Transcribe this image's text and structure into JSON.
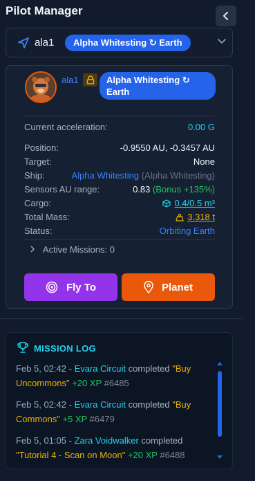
{
  "header": {
    "title": "Pilot Manager"
  },
  "selector": {
    "pilot": "ala1",
    "location": "Alpha Whitesting ↻ Earth"
  },
  "card": {
    "pilot": "ala1",
    "location": "Alpha Whitesting ↻ Earth",
    "acceleration": {
      "label": "Current acceleration:",
      "value": "0.00 G"
    },
    "position": {
      "label": "Position:",
      "value": "-0.9550 AU, -0.3457 AU"
    },
    "target": {
      "label": "Target:",
      "value": "None"
    },
    "ship": {
      "label": "Ship:",
      "name": "Alpha Whitesting",
      "alias": "(Alpha Whitesting)"
    },
    "sensors": {
      "label": "Sensors AU range:",
      "value": "0.83",
      "bonus": "(Bonus +135%)"
    },
    "cargo": {
      "label": "Cargo:",
      "value": "0.4/0.5 m³"
    },
    "mass": {
      "label": "Total Mass:",
      "value": "3.318 t"
    },
    "status": {
      "label": "Status:",
      "value": "Orbiting Earth"
    },
    "active_missions": "Active Missions: 0",
    "fly_label": "Fly To",
    "planet_label": "Planet"
  },
  "log": {
    "title": "MISSION LOG",
    "entries": [
      {
        "time": "Feb 5, 02:42",
        "who": "Evara Circuit",
        "action": "completed",
        "quest": "\"Buy Uncommons\"",
        "xp": "+20 XP",
        "id": "#6485"
      },
      {
        "time": "Feb 5, 02:42",
        "who": "Evara Circuit",
        "action": "completed",
        "quest": "\"Buy Commons\"",
        "xp": "+5 XP",
        "id": "#6479"
      },
      {
        "time": "Feb 5, 01:05",
        "who": "Zara Voidwalker",
        "action": "completed",
        "quest": "\"Tutorial 4 - Scan on Moon\"",
        "xp": "+20 XP",
        "id": "#6488"
      }
    ]
  },
  "colors": {
    "accent_blue": "#2563eb",
    "fly_purple": "#9333ea",
    "planet_orange": "#ea580c",
    "cyan": "#22d3ee"
  }
}
